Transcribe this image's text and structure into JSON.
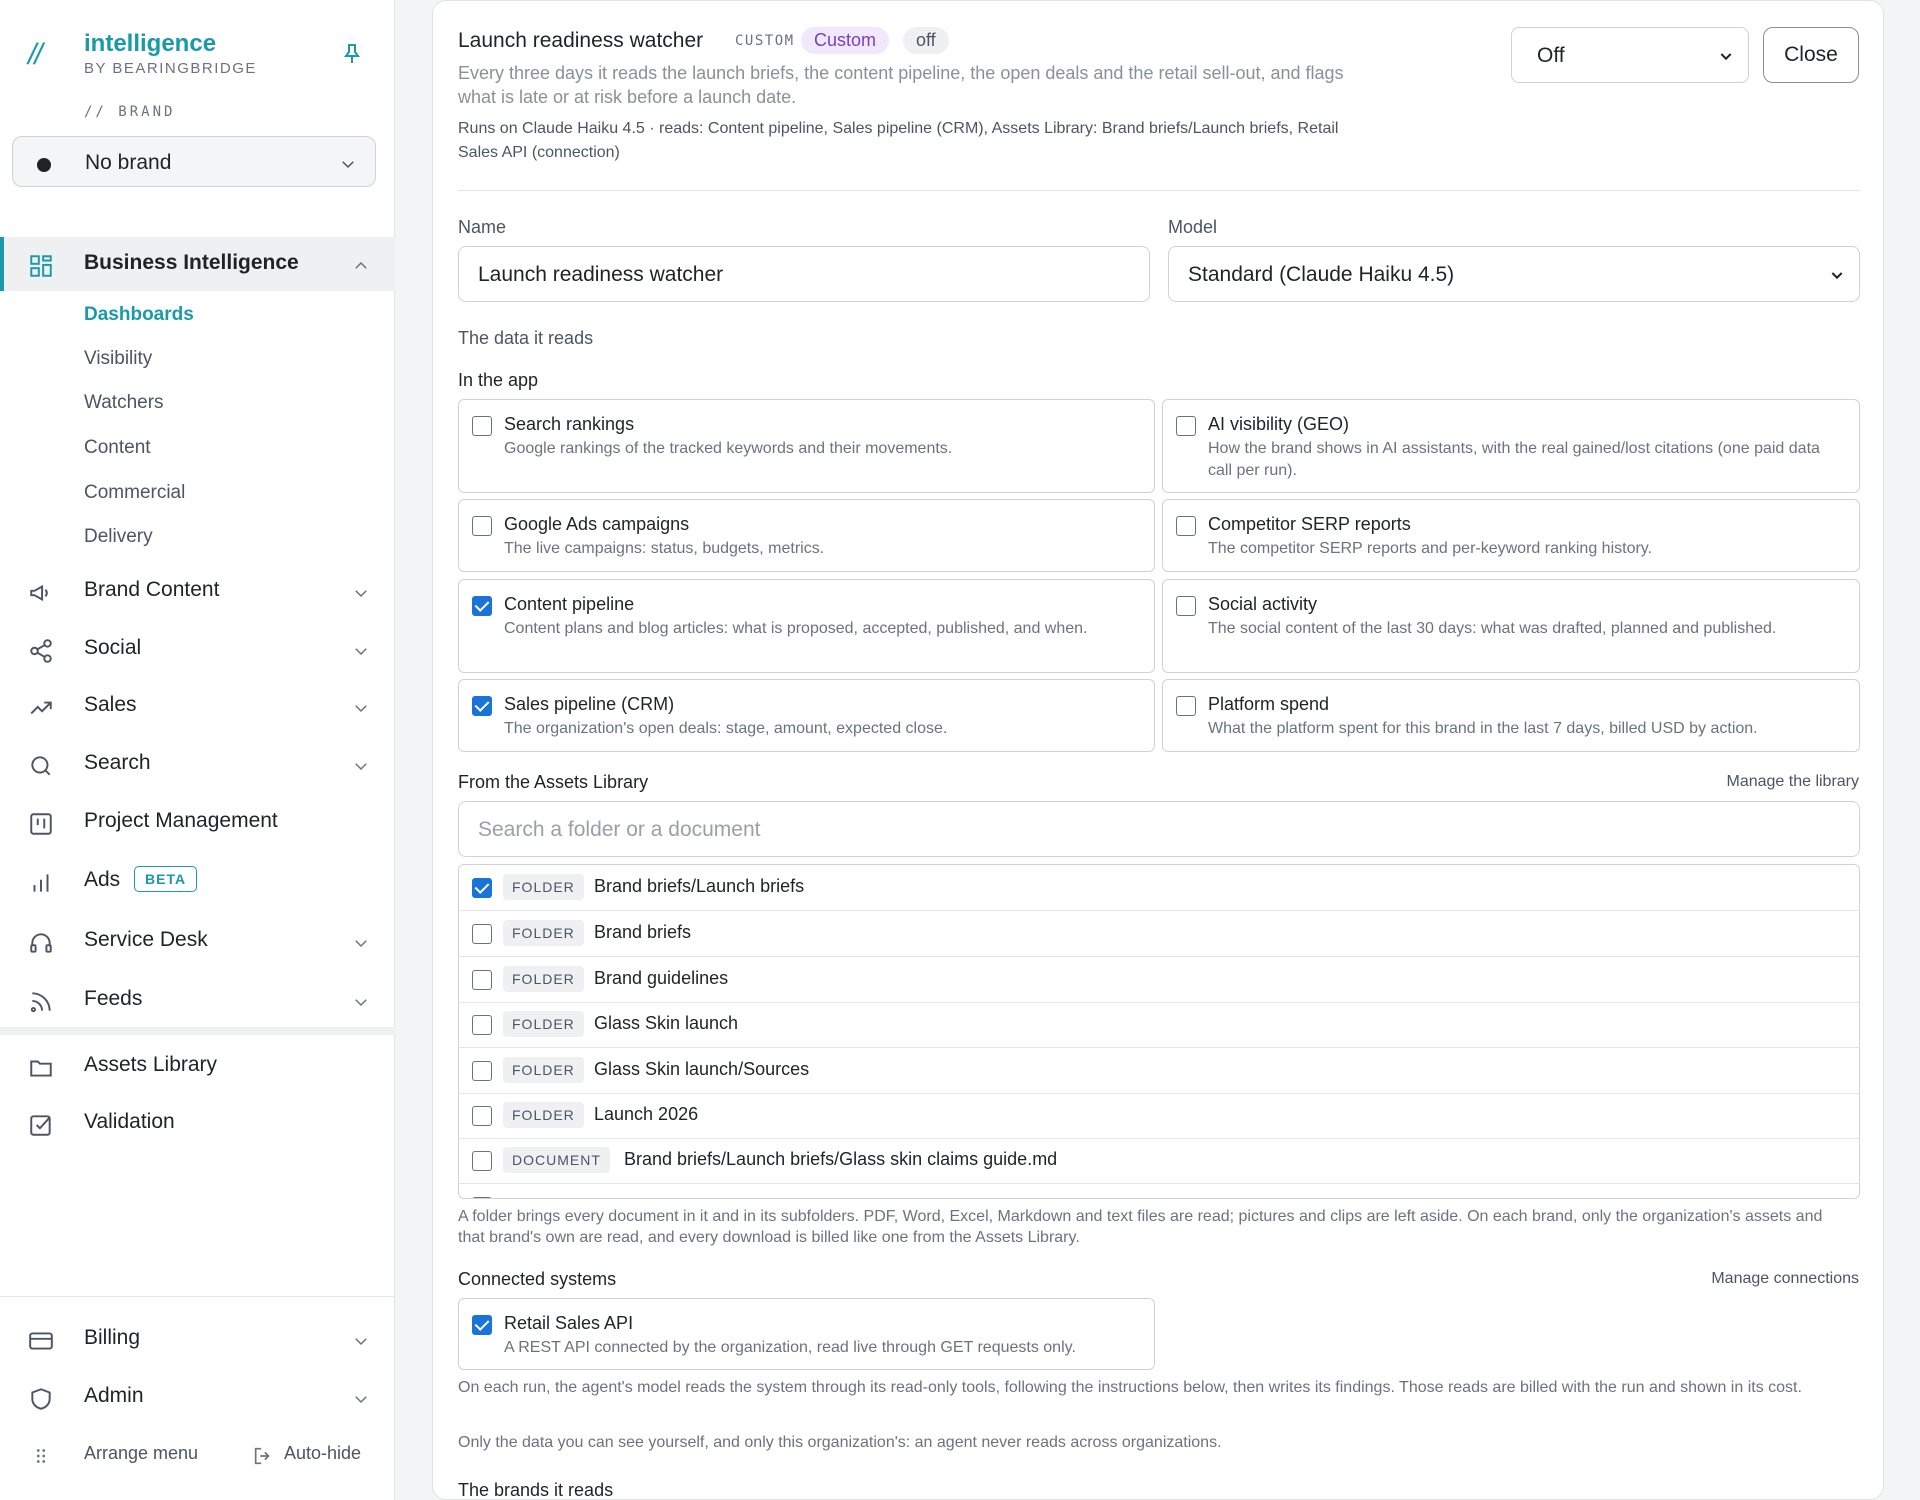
{
  "sidebar": {
    "logo": {
      "slash": "//",
      "name": "intelligence",
      "sub": "BY BEARINGBRIDGE"
    },
    "brand_caption": "// BRAND",
    "brand_select": "No brand",
    "nav": {
      "business_intelligence": "Business Intelligence",
      "sub_items": [
        "Dashboards",
        "Visibility",
        "Watchers",
        "Content",
        "Commercial",
        "Delivery"
      ],
      "brand_content": "Brand Content",
      "social": "Social",
      "sales": "Sales",
      "search": "Search",
      "project_management": "Project Management",
      "ads": "Ads",
      "ads_badge": "BETA",
      "service_desk": "Service Desk",
      "feeds": "Feeds",
      "assets_library": "Assets Library",
      "validation": "Validation",
      "billing": "Billing",
      "admin": "Admin"
    },
    "footer": {
      "arrange": "Arrange menu",
      "autohide": "Auto-hide"
    }
  },
  "panel": {
    "title": "Launch readiness watcher",
    "tag_mono": "CUSTOM",
    "tag_custom": "Custom",
    "tag_off": "off",
    "description": "Every three days it reads the launch briefs, the content pipeline, the open deals and the retail sell-out, and flags what is late or at risk before a launch date.",
    "runs": "Runs on Claude Haiku 4.5 · reads: Content pipeline, Sales pipeline (CRM), Assets Library: Brand briefs/Launch briefs, Retail Sales API (connection)",
    "status_value": "Off",
    "close_label": "Close",
    "name_label": "Name",
    "name_value": "Launch readiness watcher",
    "model_label": "Model",
    "model_value": "Standard (Claude Haiku 4.5)",
    "data_reads_label": "The data it reads",
    "in_app_label": "In the app",
    "sources": [
      {
        "title": "Search rankings",
        "desc": "Google rankings of the tracked keywords and their movements.",
        "checked": false
      },
      {
        "title": "AI visibility (GEO)",
        "desc": "How the brand shows in AI assistants, with the real gained/lost citations (one paid data call per run).",
        "checked": false
      },
      {
        "title": "Google Ads campaigns",
        "desc": "The live campaigns: status, budgets, metrics.",
        "checked": false
      },
      {
        "title": "Competitor SERP reports",
        "desc": "The competitor SERP reports and per-keyword ranking history.",
        "checked": false
      },
      {
        "title": "Content pipeline",
        "desc": "Content plans and blog articles: what is proposed, accepted, published, and when.",
        "checked": true
      },
      {
        "title": "Social activity",
        "desc": "The social content of the last 30 days: what was drafted, planned and published.",
        "checked": false
      },
      {
        "title": "Sales pipeline (CRM)",
        "desc": "The organization's open deals: stage, amount, expected close.",
        "checked": true
      },
      {
        "title": "Platform spend",
        "desc": "What the platform spent for this brand in the last 7 days, billed USD by action.",
        "checked": false
      }
    ],
    "assets_label": "From the Assets Library",
    "manage_library": "Manage the library",
    "assets_search_placeholder": "Search a folder or a document",
    "assets": [
      {
        "kind": "FOLDER",
        "name": "Brand briefs/Launch briefs",
        "checked": true
      },
      {
        "kind": "FOLDER",
        "name": "Brand briefs",
        "checked": false
      },
      {
        "kind": "FOLDER",
        "name": "Brand guidelines",
        "checked": false
      },
      {
        "kind": "FOLDER",
        "name": "Glass Skin launch",
        "checked": false
      },
      {
        "kind": "FOLDER",
        "name": "Glass Skin launch/Sources",
        "checked": false
      },
      {
        "kind": "FOLDER",
        "name": "Launch 2026",
        "checked": false
      },
      {
        "kind": "DOCUMENT",
        "name": "Brand briefs/Launch briefs/Glass skin claims guide.md",
        "checked": false
      }
    ],
    "assets_note": "A folder brings every document in it and in its subfolders. PDF, Word, Excel, Markdown and text files are read; pictures and clips are left aside. On each brand, only the organization's assets and that brand's own are read, and every download is billed like one from the Assets Library.",
    "connected_label": "Connected systems",
    "manage_connections": "Manage connections",
    "connection": {
      "title": "Retail Sales API",
      "desc": "A REST API connected by the organization, read live through GET requests only.",
      "checked": true
    },
    "connection_note": "On each run, the agent's model reads the system through its read-only tools, following the instructions below, then writes its findings. Those reads are billed with the run and shown in its cost.",
    "scope_note": "Only the data you can see yourself, and only this organization's: an agent never reads across organizations.",
    "brands_label": "The brands it reads"
  },
  "colors": {
    "accent": "#1a9aa8",
    "checkbox": "#1a73d9",
    "custom_tag": "#7a3fc5"
  }
}
